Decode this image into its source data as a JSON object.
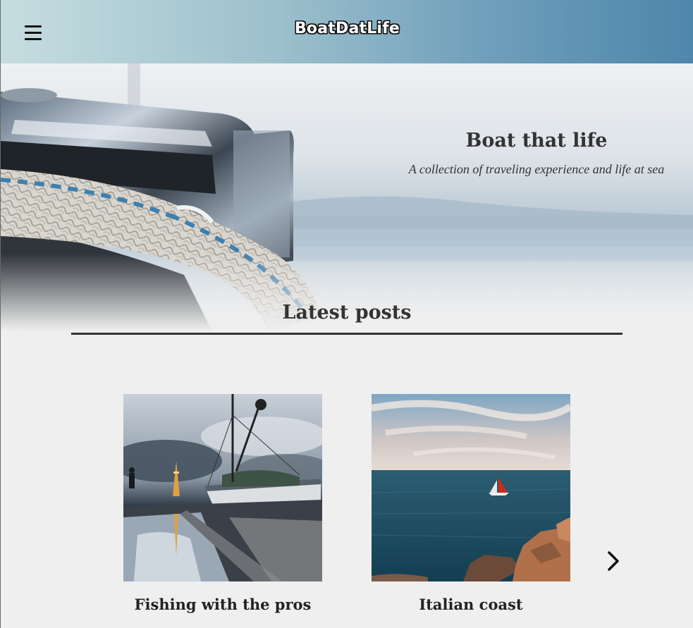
{
  "header": {
    "brand": "BoatDatLife",
    "menu_icon": "hamburger-menu-icon"
  },
  "hero": {
    "title": "Boat that life",
    "subtitle": "A collection of traveling experience and life at sea"
  },
  "posts_section": {
    "title": "Latest posts",
    "next_icon": "chevron-right-icon",
    "posts": [
      {
        "title": "Fishing with the pros"
      },
      {
        "title": "Italian coast"
      }
    ]
  },
  "colors": {
    "background": "#efefef",
    "header_gradient_start": "#c6dde0",
    "header_gradient_end": "#4f86ab",
    "text_dark": "#333333"
  }
}
